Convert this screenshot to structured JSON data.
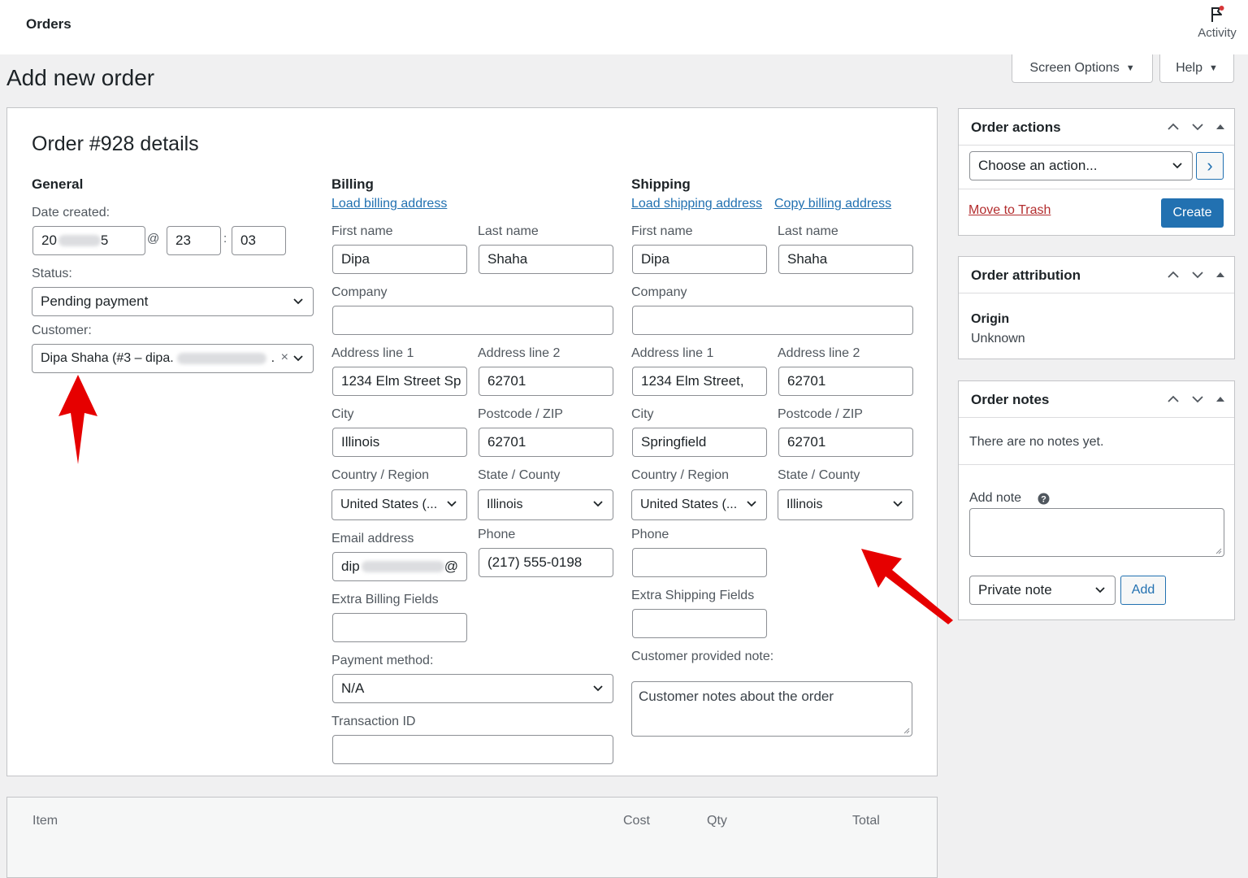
{
  "topbar": {
    "title": "Orders",
    "activity_label": "Activity"
  },
  "screen_options": {
    "label": "Screen Options"
  },
  "help": {
    "label": "Help"
  },
  "page_title": "Add new order",
  "order": {
    "heading": "Order #928 details",
    "general": {
      "title": "General",
      "date_label": "Date created:",
      "date_value_visible": "20",
      "date_value_tail": "5",
      "at_symbol": "@",
      "hour": "23",
      "colon": ":",
      "minute": "03",
      "status_label": "Status:",
      "status_value": "Pending payment",
      "customer_label": "Customer:",
      "customer_value": "Dipa Shaha (#3 – dipa.",
      "customer_tail": ".",
      "clear_symbol": "×"
    },
    "billing": {
      "title": "Billing",
      "load_link": "Load billing address",
      "first_name_label": "First name",
      "first_name": "Dipa",
      "last_name_label": "Last name",
      "last_name": "Shaha",
      "company_label": "Company",
      "company": "",
      "address1_label": "Address line 1",
      "address1": "1234 Elm Street Sp",
      "address2_label": "Address line 2",
      "address2": "62701",
      "city_label": "City",
      "city": "Illinois",
      "postcode_label": "Postcode / ZIP",
      "postcode": "62701",
      "country_label": "Country / Region",
      "country": "United States (...",
      "state_label": "State / County",
      "state": "Illinois",
      "email_label": "Email address",
      "email_visible": "dip",
      "email_tail": "@",
      "phone_label": "Phone",
      "phone": "(217) 555-0198",
      "extra_label": "Extra Billing Fields",
      "extra": "",
      "payment_label": "Payment method:",
      "payment": "N/A",
      "transaction_label": "Transaction ID",
      "transaction": ""
    },
    "shipping": {
      "title": "Shipping",
      "load_link": "Load shipping address",
      "copy_link": "Copy billing address",
      "first_name_label": "First name",
      "first_name": "Dipa",
      "last_name_label": "Last name",
      "last_name": "Shaha",
      "company_label": "Company",
      "company": "",
      "address1_label": "Address line 1",
      "address1": "1234 Elm Street,",
      "address2_label": "Address line 2",
      "address2": "62701",
      "city_label": "City",
      "city": "Springfield",
      "postcode_label": "Postcode / ZIP",
      "postcode": "62701",
      "country_label": "Country / Region",
      "country": "United States (...",
      "state_label": "State / County",
      "state": "Illinois",
      "phone_label": "Phone",
      "phone": "",
      "extra_label": "Extra Shipping Fields",
      "extra": "",
      "note_label": "Customer provided note:",
      "note_placeholder": "Customer notes about the order"
    }
  },
  "items_table": {
    "headers": [
      "Item",
      "Cost",
      "Qty",
      "Total"
    ]
  },
  "order_actions": {
    "title": "Order actions",
    "select_value": "Choose an action...",
    "go_symbol": "›",
    "trash_link": "Move to Trash",
    "create_button": "Create"
  },
  "order_attribution": {
    "title": "Order attribution",
    "origin_label": "Origin",
    "origin_value": "Unknown"
  },
  "order_notes": {
    "title": "Order notes",
    "empty_text": "There are no notes yet.",
    "add_note_label": "Add note",
    "note_type": "Private note",
    "add_button": "Add"
  },
  "colors": {
    "link": "#2271b1",
    "trash": "#b32d2e",
    "primary": "#2271b1",
    "arrow": "#e60000"
  }
}
